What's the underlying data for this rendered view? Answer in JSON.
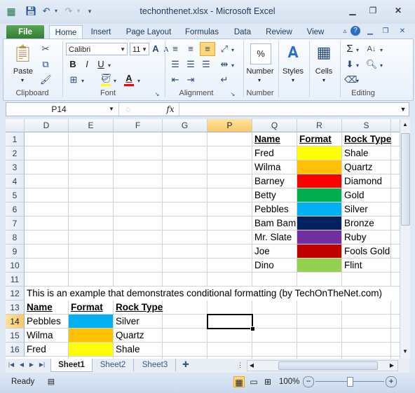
{
  "window": {
    "title": "techonthenet.xlsx  -  Microsoft Excel",
    "qat": [
      "save-icon",
      "undo-icon",
      "redo-icon",
      "customize-icon"
    ],
    "controls": [
      "minimize",
      "restore",
      "close"
    ]
  },
  "tabs": [
    "File",
    "Home",
    "Insert",
    "Page Layout",
    "Formulas",
    "Data",
    "Review",
    "View"
  ],
  "ribbon": {
    "clipboard": {
      "label": "Clipboard",
      "paste": "Paste"
    },
    "font": {
      "label": "Font",
      "name": "Calibri",
      "size": "11",
      "bold": "B",
      "italic": "I",
      "underline": "U",
      "font_color": "#ff0000",
      "fill_color": "#ffff00",
      "grow": "A",
      "shrink": "A"
    },
    "alignment": {
      "label": "Alignment"
    },
    "number": {
      "label": "Number",
      "symbol": "%",
      "button": "Number"
    },
    "styles": {
      "label": "Styles",
      "button": "Styles"
    },
    "cells": {
      "label": "Cells",
      "button": "Cells"
    },
    "editing": {
      "label": "Editing",
      "sum": "Σ"
    }
  },
  "formula_bar": {
    "name_box": "P14",
    "fx": "fx",
    "value": ""
  },
  "columns": [
    "D",
    "E",
    "F",
    "G",
    "P",
    "Q",
    "R",
    "S"
  ],
  "selected_column": "P",
  "rows": [
    "1",
    "2",
    "3",
    "4",
    "5",
    "6",
    "7",
    "8",
    "9",
    "10",
    "11",
    "12",
    "13",
    "14",
    "15",
    "16"
  ],
  "selected_row": "14",
  "table_top": {
    "headers": [
      "Name",
      "Format",
      "Rock Type"
    ],
    "rows": [
      {
        "name": "Fred",
        "color": "#ffff00",
        "rock": "Shale"
      },
      {
        "name": "Wilma",
        "color": "#ffc000",
        "rock": "Quartz"
      },
      {
        "name": "Barney",
        "color": "#ff0000",
        "rock": "Diamond"
      },
      {
        "name": "Betty",
        "color": "#00b050",
        "rock": "Gold"
      },
      {
        "name": "Pebbles",
        "color": "#00b0f0",
        "rock": "Silver"
      },
      {
        "name": "Bam Bam",
        "color": "#002060",
        "rock": "Bronze"
      },
      {
        "name": "Mr. Slate",
        "color": "#7030a0",
        "rock": "Ruby"
      },
      {
        "name": "Joe",
        "color": "#c00000",
        "rock": "Fools Gold"
      },
      {
        "name": "Dino",
        "color": "#92d050",
        "rock": "Flint"
      }
    ]
  },
  "note": "This is an example that demonstrates conditional formatting (by TechOnTheNet.com)",
  "table_bottom": {
    "headers": [
      "Name",
      "Format",
      "Rock Type"
    ],
    "rows": [
      {
        "name": "Pebbles",
        "color": "#00b0f0",
        "rock": "Silver"
      },
      {
        "name": "Wilma",
        "color": "#ffc000",
        "rock": "Quartz"
      },
      {
        "name": "Fred",
        "color": "#ffff00",
        "rock": "Shale"
      }
    ]
  },
  "sheets": [
    "Sheet1",
    "Sheet2",
    "Sheet3"
  ],
  "active_sheet": "Sheet1",
  "status": {
    "mode": "Ready",
    "zoom": "100%"
  }
}
